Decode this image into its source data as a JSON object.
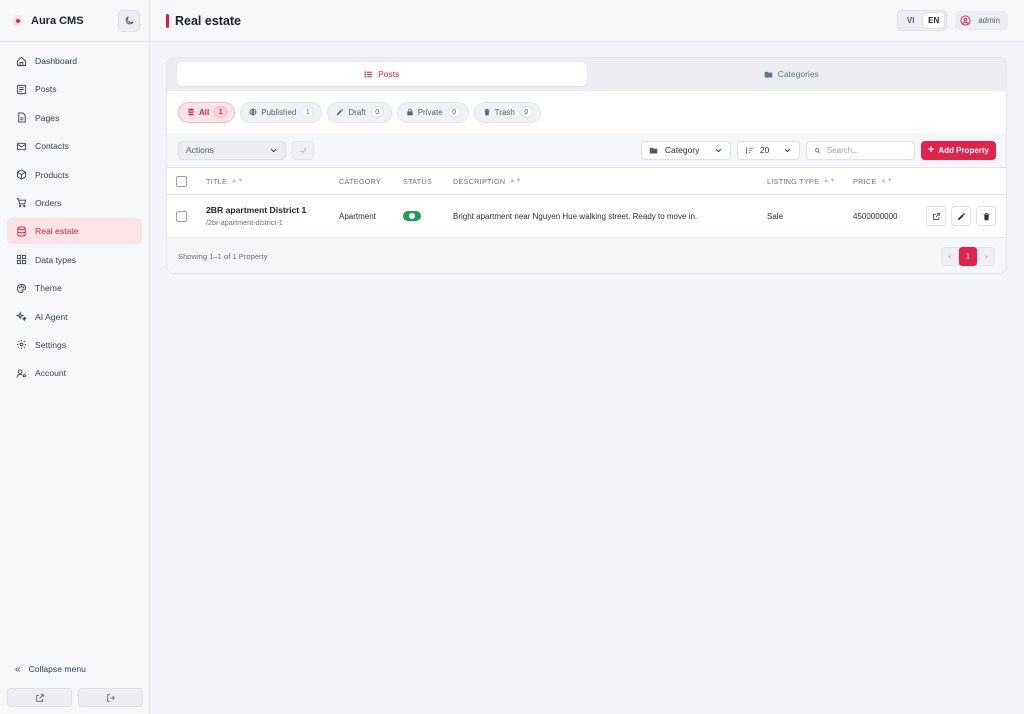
{
  "app": {
    "name": "Aura CMS"
  },
  "sidebar": {
    "items": [
      {
        "label": "Dashboard",
        "icon": "home-icon"
      },
      {
        "label": "Posts",
        "icon": "posts-icon"
      },
      {
        "label": "Pages",
        "icon": "page-icon"
      },
      {
        "label": "Contacts",
        "icon": "mail-icon"
      },
      {
        "label": "Products",
        "icon": "box-icon"
      },
      {
        "label": "Orders",
        "icon": "cart-icon"
      },
      {
        "label": "Real estate",
        "icon": "database-icon",
        "active": true
      },
      {
        "label": "Data types",
        "icon": "grid-icon"
      },
      {
        "label": "Theme",
        "icon": "palette-icon"
      },
      {
        "label": "AI Agent",
        "icon": "sparkle-icon"
      },
      {
        "label": "Settings",
        "icon": "gear-icon"
      },
      {
        "label": "Account",
        "icon": "user-gear-icon"
      }
    ],
    "collapse_label": "Collapse menu"
  },
  "header": {
    "title": "Real estate",
    "languages": [
      "VI",
      "EN"
    ],
    "active_language": "EN",
    "user": "admin"
  },
  "tabs": [
    {
      "label": "Posts",
      "active": true
    },
    {
      "label": "Categories",
      "active": false
    }
  ],
  "status_filters": [
    {
      "label": "All",
      "count": "1",
      "active": true
    },
    {
      "label": "Published",
      "count": "1"
    },
    {
      "label": "Draft",
      "count": "0"
    },
    {
      "label": "Private",
      "count": "0"
    },
    {
      "label": "Trash",
      "count": "0"
    }
  ],
  "toolbar": {
    "actions_label": "Actions",
    "category_label": "Category",
    "per_page": "20",
    "search_placeholder": "Search...",
    "add_label": "Add Property"
  },
  "table": {
    "columns": [
      "TITLE",
      "CATEGORY",
      "STATUS",
      "DESCRIPTION",
      "LISTING TYPE",
      "PRICE"
    ],
    "rows": [
      {
        "title": "2BR apartment District 1",
        "slug": "/2br-apartment-district-1",
        "category": "Apartment",
        "status": "published",
        "description": "Bright apartment near Nguyen Hue walking street. Ready to move in.",
        "listing_type": "Sale",
        "price": "4500000000"
      }
    ],
    "footer": "Showing 1–1 of 1 Property",
    "current_page": "1"
  },
  "colors": {
    "accent": "#e0244d",
    "status_on": "#1e9e55"
  }
}
